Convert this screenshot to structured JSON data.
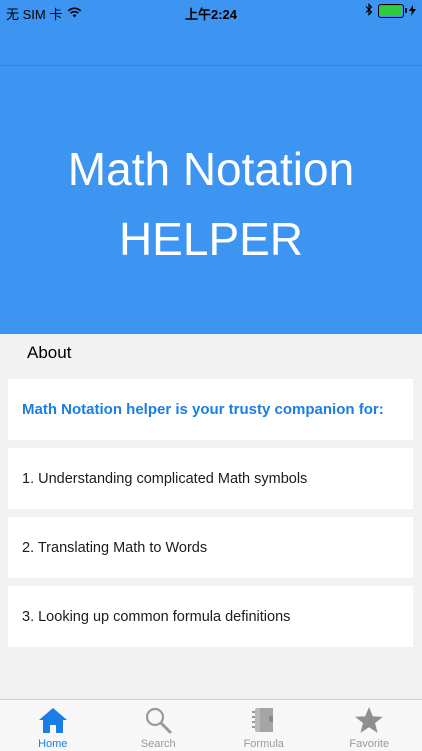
{
  "status": {
    "carrier": "无 SIM 卡",
    "time": "上午2:24",
    "icons": [
      "wifi-icon",
      "bluetooth-icon",
      "battery-icon",
      "charging-icon"
    ]
  },
  "hero": {
    "line1": "Math Notation",
    "line2": "HELPER",
    "background": "#3e95f1"
  },
  "section": {
    "title": "About"
  },
  "cards": [
    {
      "text": "Math Notation helper is your trusty companion for:"
    },
    {
      "text": "1. Understanding complicated Math symbols"
    },
    {
      "text": "2. Translating Math to Words"
    },
    {
      "text": "3. Looking up common formula definitions"
    }
  ],
  "tabs": [
    {
      "label": "Home",
      "icon": "home-icon",
      "active": true
    },
    {
      "label": "Search",
      "icon": "search-icon",
      "active": false
    },
    {
      "label": "Formula",
      "icon": "notebook-icon",
      "active": false
    },
    {
      "label": "Favorite",
      "icon": "star-icon",
      "active": false
    }
  ],
  "colors": {
    "accent": "#1a7ee6",
    "inactive": "#9a9a9a"
  }
}
